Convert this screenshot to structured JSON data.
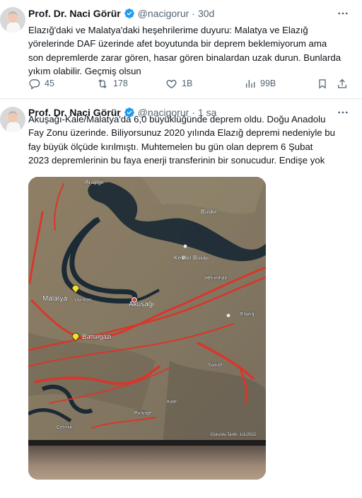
{
  "tweets": [
    {
      "author_name": "Prof. Dr. Naci Görür",
      "handle": "@nacigorur",
      "separator": "·",
      "time": "30d",
      "text_lines": [
        "Elazığ'daki ve Malatya'daki heşehrilerime duyuru: Malatya ve Elazığ",
        "yörelerinde DAF üzerinde afet boyutunda bir deprem beklemiyorum ama",
        "son depremlerde zarar gören, hasar gören binalardan uzak durun. Bunlarda",
        "yıkım olabilir. Geçmiş olsun"
      ],
      "stats": {
        "replies": "45",
        "retweets": "178",
        "likes": "1B",
        "views": "99B"
      }
    },
    {
      "author_name": "Prof. Dr. Naci Görür",
      "handle": "@nacigorur",
      "separator": "·",
      "time": "1 sa",
      "text_lines": [
        "Akuşağı-Kale/Malatya'da 6,0 büyüklüğünde deprem oldu. Doğu Anadolu",
        "Fay Zonu üzerinde. Biliyorsunuz 2020 yılında Elazığ depremi nedeniyle bu",
        "fay büyük ölçüde kırılmıştı. Muhtemelen bu gün olan deprem 6 Şubat",
        "2023 depremlerinin bu faya enerji transferinin bir sonucudur. Endişe yok"
      ],
      "map_labels": {
        "arapgir": "Arapgir",
        "baskil": "Baskil",
        "keban": "Keban Barajı",
        "malatya": "Malatya",
        "akusagi": "Akuşağı",
        "yazihan": "Yazıhan",
        "hekimhan": "Hekimhan",
        "elazig": "Elazığ",
        "battalgazi": "Battalgazi",
        "sivrice": "Sivrice",
        "kale": "Kale",
        "putuge": "Pütürge",
        "cermik": "Çermik",
        "footer": "Görüntü Tarihi: 1/1/2022"
      }
    }
  ],
  "colors": {
    "text": "#0f1419",
    "muted": "#536471",
    "verified": "#1d9bf0",
    "fault": "#d9362b"
  },
  "icons": [
    "verified-badge-icon",
    "more-icon",
    "reply-icon",
    "retweet-icon",
    "like-icon",
    "views-icon",
    "bookmark-icon",
    "share-icon"
  ]
}
